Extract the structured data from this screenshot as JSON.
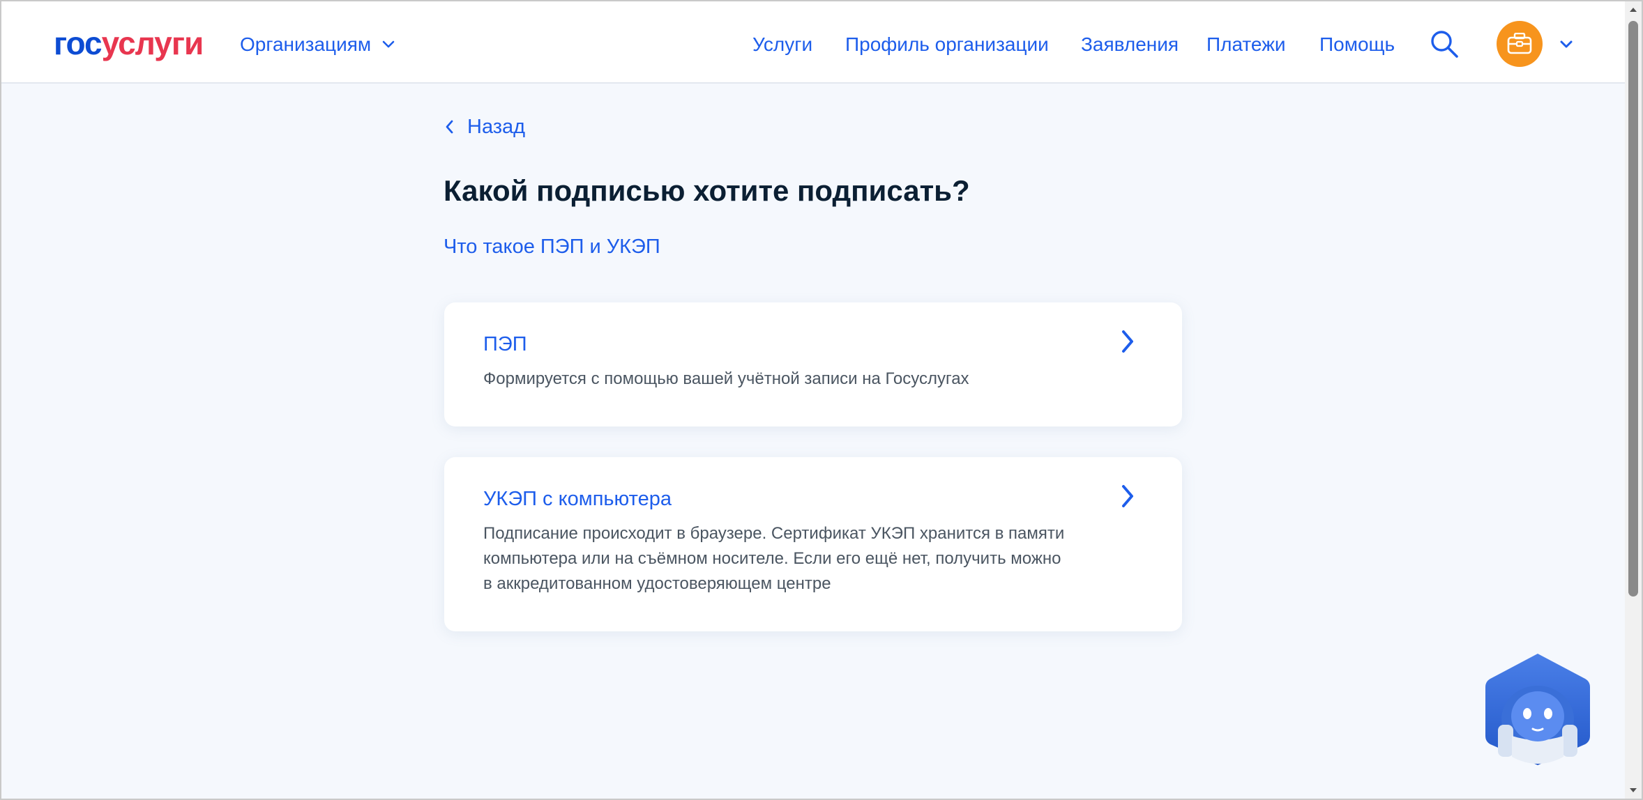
{
  "header": {
    "logo": {
      "part1": "гос",
      "part2": "услуги"
    },
    "org_menu_label": "Организациям",
    "nav": [
      "Услуги",
      "Профиль организации",
      "Заявления",
      "Платежи",
      "Помощь"
    ]
  },
  "main": {
    "back_label": "Назад",
    "title": "Какой подписью хотите подписать?",
    "info_link": "Что такое ПЭП и УКЭП",
    "options": [
      {
        "title": "ПЭП",
        "description": "Формируется с помощью вашей учётной записи на Госуслугах"
      },
      {
        "title": "УКЭП с компьютера",
        "description": "Подписание происходит в браузере. Сертификат УКЭП хранится в памяти\nкомпьютера или на съёмном носителе. Если его ещё нет, получить можно\nв аккредитованном удостоверяющем центре"
      }
    ]
  },
  "icons": {
    "search": "search-icon",
    "avatar": "briefcase-icon",
    "assistant": "robot-assistant-icon"
  },
  "colors": {
    "brand_blue": "#0d4cd3",
    "brand_red": "#e8364f",
    "link_blue": "#1d5deb",
    "avatar_orange": "#f7941d",
    "page_bg": "#f5f8fd",
    "text_dark": "#0b1f33"
  }
}
